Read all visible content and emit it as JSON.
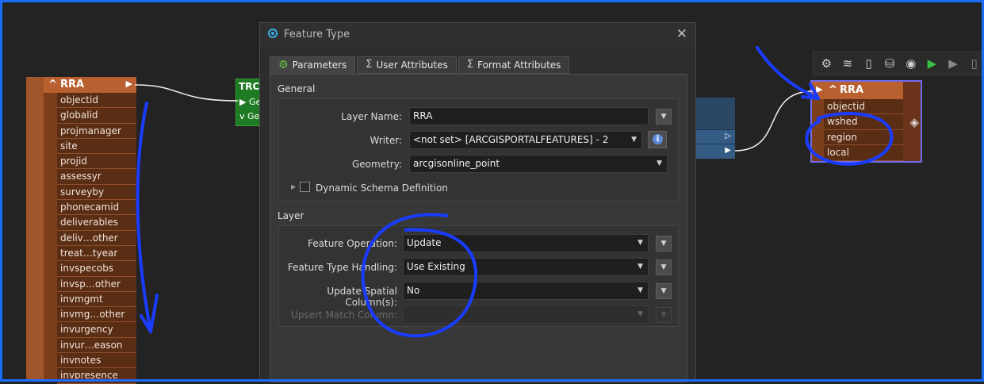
{
  "source_node": {
    "title": "RRA",
    "attributes": [
      "objectid",
      "globalid",
      "projmanager",
      "site",
      "projid",
      "assessyr",
      "surveyby",
      "phonecamid",
      "deliverables",
      "deliv…other",
      "treat…tyear",
      "invspecobs",
      "invsp…other",
      "invmgmt",
      "invmg…other",
      "invurgency",
      "invur…eason",
      "invnotes",
      "invpresence"
    ]
  },
  "transformer_node": {
    "title": "TRC",
    "port1": "Ge",
    "port2": "Ge"
  },
  "dest_node": {
    "title": "RRA",
    "attributes": [
      "objectid",
      "wshed",
      "region",
      "local"
    ]
  },
  "toolbar": {
    "icons": [
      "gear-icon",
      "layers-icon",
      "save-icon",
      "cache-icon",
      "view-icon",
      "run-icon",
      "run-to-icon",
      "more-icon"
    ]
  },
  "dialog": {
    "title": "Feature Type",
    "tabs": [
      "Parameters",
      "User Attributes",
      "Format Attributes"
    ],
    "general": {
      "section_title": "General",
      "layer_name_label": "Layer Name:",
      "layer_name_value": "RRA",
      "writer_label": "Writer:",
      "writer_value": "<not set> [ARCGISPORTALFEATURES] - 2",
      "geometry_label": "Geometry:",
      "geometry_value": "arcgisonline_point",
      "dynamic_schema_label": "Dynamic Schema Definition"
    },
    "layer": {
      "section_title": "Layer",
      "feature_operation_label": "Feature Operation:",
      "feature_operation_value": "Update",
      "feature_type_handling_label": "Feature Type Handling:",
      "feature_type_handling_value": "Use Existing",
      "update_spatial_label": "Update Spatial Column(s):",
      "update_spatial_value": "No",
      "upsert_match_label": "Upsert Match Column:",
      "upsert_match_value": ""
    }
  },
  "colors": {
    "annotation": "#1a3cff",
    "node_header": "#b8602f",
    "node_body": "#7d3e1c",
    "transformer": "#1e7b24"
  }
}
